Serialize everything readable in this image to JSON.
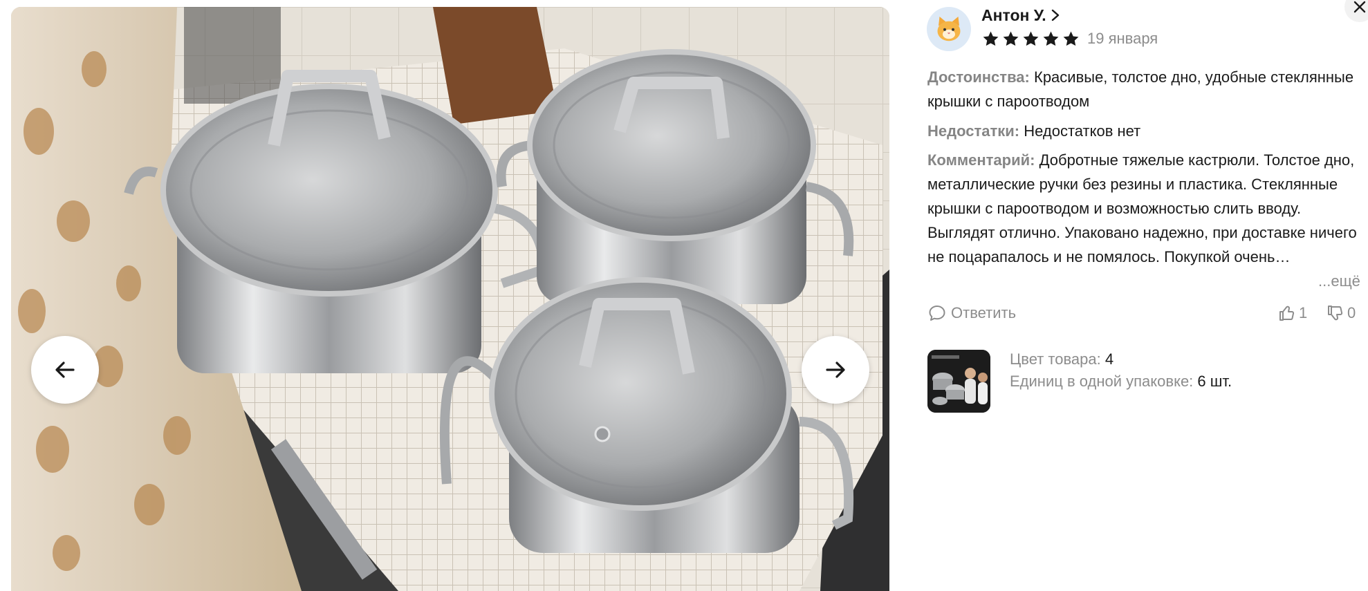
{
  "review": {
    "author": "Антон У.",
    "rating": 5,
    "rating_max": 5,
    "date": "19 января",
    "pros_label": "Достоинства:",
    "pros_text": "Красивые, толстое дно, удобные стеклянные крышки с пароотводом",
    "cons_label": "Недостатки:",
    "cons_text": "Недостатков нет",
    "comment_label": "Комментарий:",
    "comment_text": "Добротные тяжелые кастрюли. Толстое дно, металлические ручки без резины и пластика. Стеклянные крышки с пароотводом и возможностью слить вводу. Выглядят отлично. Упаковано надежно, при доставке ничего не поцарапалось и не помялось. Покупкой очень…",
    "more_label": "...ещё",
    "reply_label": "Ответить",
    "likes": "1",
    "dislikes": "0"
  },
  "product": {
    "color_label": "Цвет товара:",
    "color_value": "4",
    "units_label": "Единиц в одной упаковке:",
    "units_value": "6 шт."
  },
  "colors": {
    "star": "#1a1a1a",
    "muted": "#8c8c8c",
    "text": "#1a1a1a"
  },
  "icons": {
    "prev": "arrow-left-icon",
    "next": "arrow-right-icon",
    "close": "close-icon",
    "reply": "speech-bubble-icon",
    "like": "thumbs-up-icon",
    "dislike": "thumbs-down-icon"
  }
}
